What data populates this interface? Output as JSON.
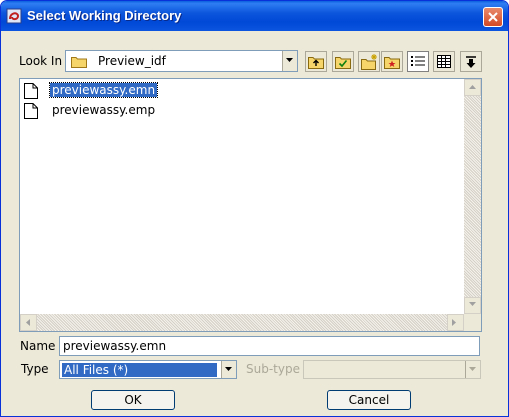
{
  "window": {
    "title": "Select Working Directory"
  },
  "toolbar": {
    "look_in_label": "Look In",
    "look_in_value": "Preview_idf",
    "buttons": [
      "up-folder-icon",
      "home-folder-icon",
      "new-folder-icon",
      "bookmark-folder-icon",
      "list-view-icon",
      "details-view-icon",
      "sort-icon"
    ]
  },
  "files": [
    {
      "name": "previewassy.emn",
      "selected": true
    },
    {
      "name": "previewassy.emp",
      "selected": false
    }
  ],
  "name_field": {
    "label": "Name",
    "value": "previewassy.emn"
  },
  "type_field": {
    "label": "Type",
    "value": "All Files (*)"
  },
  "subtype_field": {
    "label": "Sub-type",
    "value": ""
  },
  "buttons": {
    "ok": "OK",
    "cancel": "Cancel"
  },
  "colors": {
    "title_bar": "#0054e3",
    "selection": "#316ac5",
    "dialog_bg": "#ece9d8"
  }
}
